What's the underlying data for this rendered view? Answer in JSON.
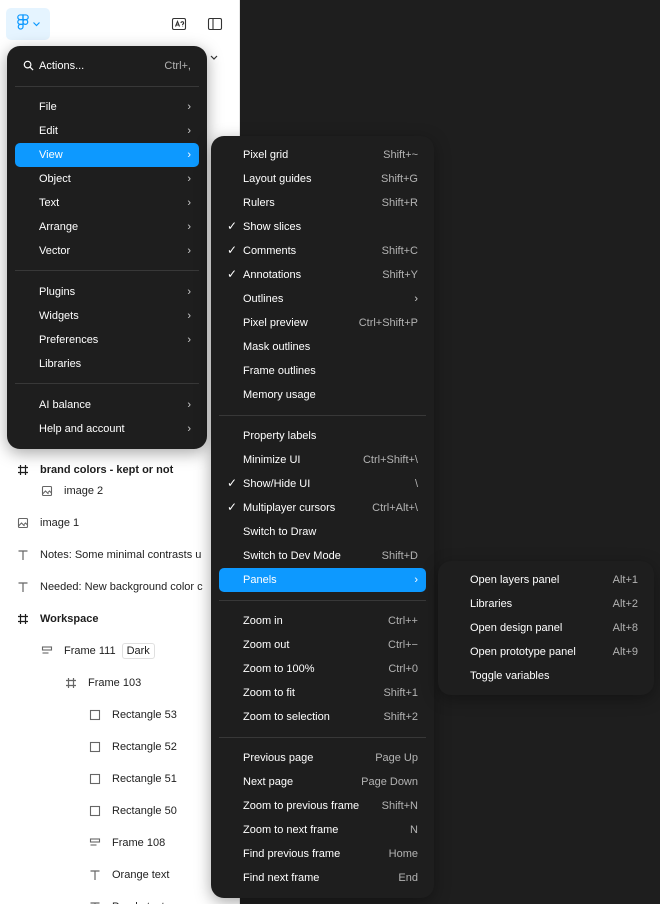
{
  "main_menu": {
    "actions": {
      "label": "Actions...",
      "shortcut": "Ctrl+,"
    },
    "groups": [
      [
        {
          "label": "File"
        },
        {
          "label": "Edit"
        },
        {
          "label": "View"
        },
        {
          "label": "Object"
        },
        {
          "label": "Text"
        },
        {
          "label": "Arrange"
        },
        {
          "label": "Vector"
        }
      ],
      [
        {
          "label": "Plugins"
        },
        {
          "label": "Widgets"
        },
        {
          "label": "Preferences"
        },
        {
          "label": "Libraries"
        }
      ],
      [
        {
          "label": "AI balance"
        },
        {
          "label": "Help and account"
        }
      ]
    ]
  },
  "view_menu": {
    "groups": [
      [
        {
          "label": "Pixel grid",
          "shortcut": "Shift+~",
          "checked": false
        },
        {
          "label": "Layout guides",
          "shortcut": "Shift+G",
          "checked": false
        },
        {
          "label": "Rulers",
          "shortcut": "Shift+R",
          "checked": false
        },
        {
          "label": "Show slices",
          "shortcut": "",
          "checked": true
        },
        {
          "label": "Comments",
          "shortcut": "Shift+C",
          "checked": true
        },
        {
          "label": "Annotations",
          "shortcut": "Shift+Y",
          "checked": true
        },
        {
          "label": "Outlines",
          "shortcut": "",
          "checked": false
        },
        {
          "label": "Pixel preview",
          "shortcut": "Ctrl+Shift+P",
          "checked": false
        },
        {
          "label": "Mask outlines",
          "shortcut": "",
          "checked": false
        },
        {
          "label": "Frame outlines",
          "shortcut": "",
          "checked": false
        },
        {
          "label": "Memory usage",
          "shortcut": "",
          "checked": false
        }
      ],
      [
        {
          "label": "Property labels",
          "shortcut": "",
          "checked": false
        },
        {
          "label": "Minimize UI",
          "shortcut": "Ctrl+Shift+\\",
          "checked": false
        },
        {
          "label": "Show/Hide UI",
          "shortcut": "\\",
          "checked": true
        },
        {
          "label": "Multiplayer cursors",
          "shortcut": "Ctrl+Alt+\\",
          "checked": true
        },
        {
          "label": "Switch to Draw",
          "shortcut": "",
          "checked": false
        },
        {
          "label": "Switch to Dev Mode",
          "shortcut": "Shift+D",
          "checked": false
        },
        {
          "label": "Panels",
          "shortcut": "",
          "checked": false
        }
      ],
      [
        {
          "label": "Zoom in",
          "shortcut": "Ctrl++",
          "checked": false
        },
        {
          "label": "Zoom out",
          "shortcut": "Ctrl+−",
          "checked": false
        },
        {
          "label": "Zoom to 100%",
          "shortcut": "Ctrl+0",
          "checked": false
        },
        {
          "label": "Zoom to fit",
          "shortcut": "Shift+1",
          "checked": false
        },
        {
          "label": "Zoom to selection",
          "shortcut": "Shift+2",
          "checked": false
        }
      ],
      [
        {
          "label": "Previous page",
          "shortcut": "Page Up",
          "checked": false
        },
        {
          "label": "Next page",
          "shortcut": "Page Down",
          "checked": false
        },
        {
          "label": "Zoom to previous frame",
          "shortcut": "Shift+N",
          "checked": false
        },
        {
          "label": "Zoom to next frame",
          "shortcut": "N",
          "checked": false
        },
        {
          "label": "Find previous frame",
          "shortcut": "Home",
          "checked": false
        },
        {
          "label": "Find next frame",
          "shortcut": "End",
          "checked": false
        }
      ]
    ]
  },
  "panels_menu": {
    "items": [
      {
        "label": "Open layers panel",
        "shortcut": "Alt+1"
      },
      {
        "label": "Libraries",
        "shortcut": "Alt+2"
      },
      {
        "label": "Open design panel",
        "shortcut": "Alt+8"
      },
      {
        "label": "Open prototype panel",
        "shortcut": "Alt+9"
      },
      {
        "label": "Toggle variables",
        "shortcut": ""
      }
    ]
  },
  "layers": [
    {
      "label": "brand colors - kept or not",
      "icon": "frame-icon",
      "level": 0,
      "bold": true
    },
    {
      "label": "image 2",
      "icon": "image-icon",
      "level": 1
    },
    {
      "label": "image 1",
      "icon": "image-icon",
      "level": 0
    },
    {
      "label": "Notes: Some minimal contrasts u",
      "icon": "text-icon",
      "level": 0
    },
    {
      "label": "Needed: New background color c",
      "icon": "text-icon",
      "level": 0
    },
    {
      "label": "Workspace",
      "icon": "frame-icon",
      "level": 0,
      "bold": true
    },
    {
      "label": "Frame 111",
      "icon": "auto-layout-icon",
      "level": 1,
      "tag": "Dark"
    },
    {
      "label": "Frame 103",
      "icon": "frame-icon",
      "level": 2
    },
    {
      "label": "Rectangle 53",
      "icon": "rectangle-icon",
      "level": 3
    },
    {
      "label": "Rectangle 52",
      "icon": "rectangle-icon",
      "level": 3
    },
    {
      "label": "Rectangle 51",
      "icon": "rectangle-icon",
      "level": 3
    },
    {
      "label": "Rectangle 50",
      "icon": "rectangle-icon",
      "level": 3
    },
    {
      "label": "Frame 108",
      "icon": "auto-layout-icon",
      "level": 3
    },
    {
      "label": "Orange text",
      "icon": "text-icon",
      "level": 3
    },
    {
      "label": "Purple text",
      "icon": "text-icon",
      "level": 3
    }
  ],
  "colors": {
    "accent": "#0d99ff",
    "menu_bg": "#1e1e1e",
    "canvas": "#1e1e1e"
  }
}
